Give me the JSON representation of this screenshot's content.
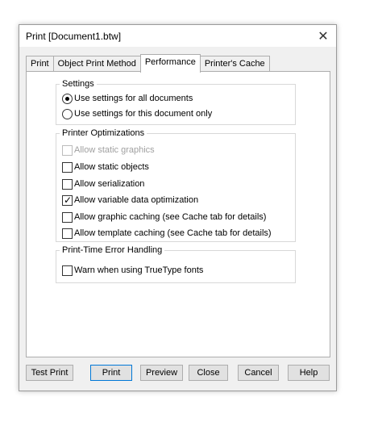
{
  "window": {
    "title": "Print [Document1.btw]",
    "close_glyph": "✕"
  },
  "tabs": [
    {
      "label": "Print",
      "active": false
    },
    {
      "label": "Object Print Method",
      "active": false
    },
    {
      "label": "Performance",
      "active": true
    },
    {
      "label": "Printer's Cache",
      "active": false
    }
  ],
  "settings": {
    "title": "Settings",
    "options": [
      {
        "label": "Use settings for all documents",
        "selected": true
      },
      {
        "label": "Use settings for this document only",
        "selected": false
      }
    ]
  },
  "printer_optimizations": {
    "title": "Printer Optimizations",
    "options": [
      {
        "label": "Allow static graphics",
        "checked": false,
        "enabled": false
      },
      {
        "label": "Allow static objects",
        "checked": false,
        "enabled": true
      },
      {
        "label": "Allow serialization",
        "checked": false,
        "enabled": true
      },
      {
        "label": "Allow variable data optimization",
        "checked": true,
        "enabled": true
      },
      {
        "label": "Allow graphic caching (see Cache tab for details)",
        "checked": false,
        "enabled": true
      },
      {
        "label": "Allow template caching (see Cache tab for details)",
        "checked": false,
        "enabled": true
      }
    ]
  },
  "error_handling": {
    "title": "Print-Time Error Handling",
    "options": [
      {
        "label": "Warn when using TrueType fonts",
        "checked": false,
        "enabled": true
      }
    ]
  },
  "buttons": {
    "test_print": "Test Print",
    "print": "Print",
    "preview": "Preview",
    "close": "Close",
    "cancel": "Cancel",
    "help": "Help"
  },
  "check_glyph": "✓",
  "colors": {
    "accent": "#0078d7",
    "disabled_text": "#a0a0a0"
  }
}
